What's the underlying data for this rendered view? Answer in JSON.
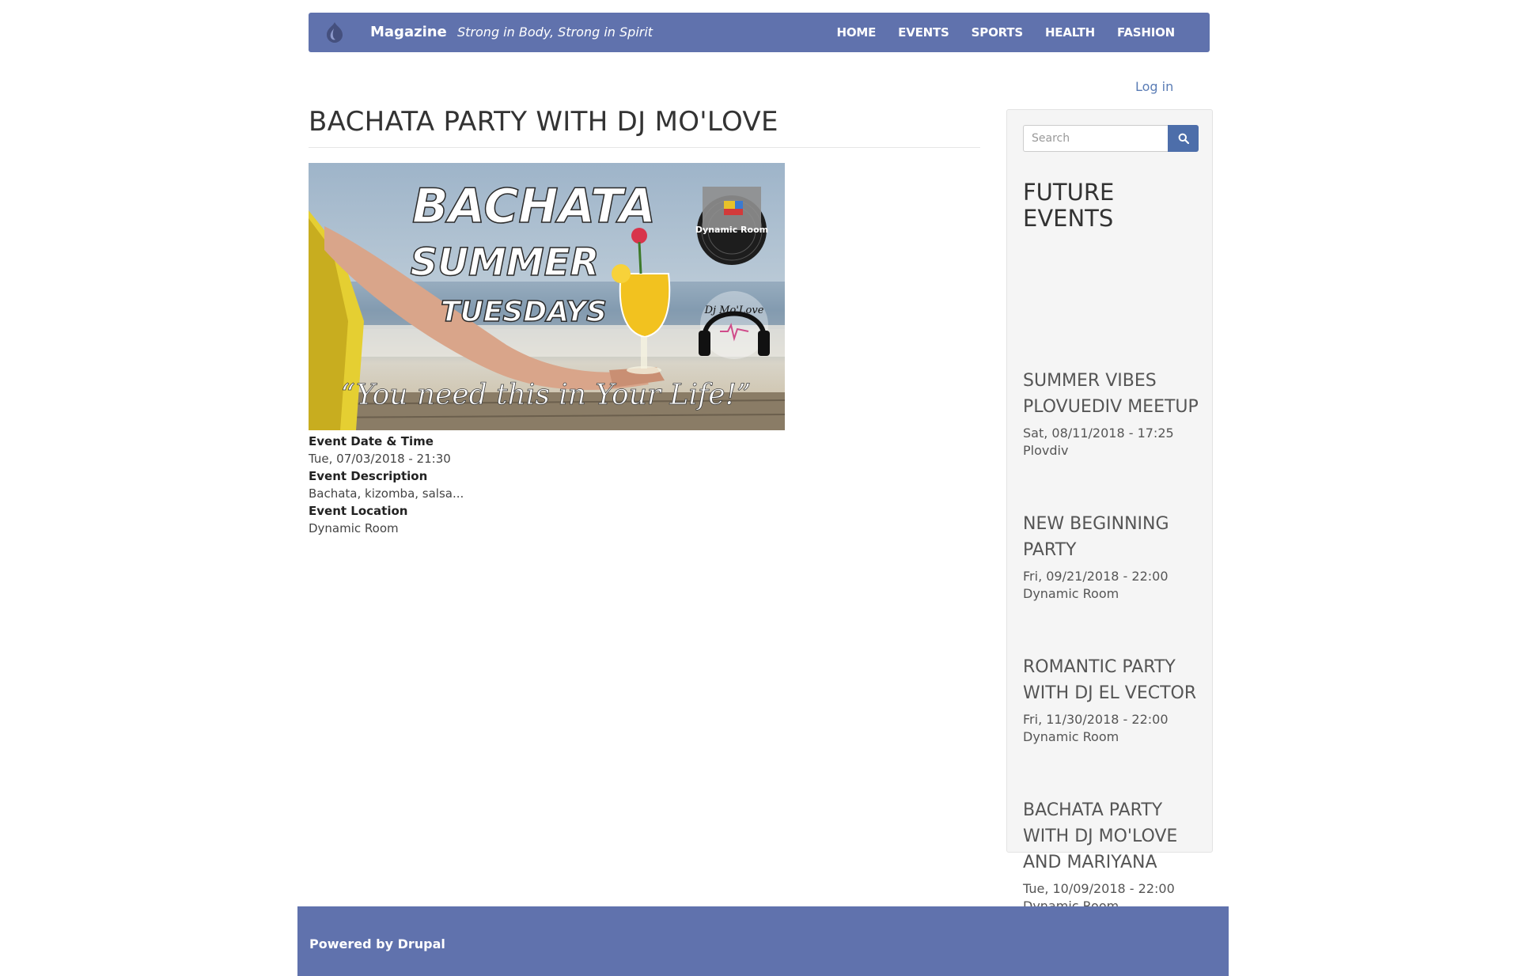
{
  "header": {
    "brand": "Magazine",
    "slogan": "Strong in Body, Strong in Spirit",
    "nav": [
      "HOME",
      "EVENTS",
      "SPORTS",
      "HEALTH",
      "FASHION"
    ],
    "accent_color": "#6072ad"
  },
  "user": {
    "login_label": "Log in"
  },
  "main": {
    "title": "BACHATA PARTY WITH DJ MO'LOVE",
    "image": {
      "headline_1": "BACHATA",
      "headline_2": "SUMMER",
      "headline_3": "TUESDAYS",
      "tagline": "“You need this in Your Life!”",
      "logo_1": "Dynamic Room",
      "logo_2": "Dj Mo'Love"
    },
    "fields": [
      {
        "label": "Event Date & Time",
        "value": "Tue, 07/03/2018 - 21:30"
      },
      {
        "label": "Event Description",
        "value": "Bachata, kizomba, salsa..."
      },
      {
        "label": "Event Location",
        "value": "Dynamic Room"
      }
    ]
  },
  "sidebar": {
    "search": {
      "placeholder": "Search",
      "button_icon": "search-icon"
    },
    "block_title": "FUTURE EVENTS",
    "events": [
      {
        "title": "SUMMER VIBES PLOVUEDIV MEETUP",
        "date": "Sat, 08/11/2018 - 17:25",
        "location": "Plovdiv"
      },
      {
        "title": "NEW BEGINNING PARTY",
        "date": "Fri, 09/21/2018 - 22:00",
        "location": "Dynamic Room"
      },
      {
        "title": "ROMANTIC PARTY WITH DJ EL VECTOR",
        "date": "Fri, 11/30/2018 - 22:00",
        "location": "Dynamic Room"
      },
      {
        "title": "BACHATA PARTY WITH DJ MO'LOVE AND MARIYANA",
        "date": "Tue, 10/09/2018 - 22:00",
        "location": "Dynamic Room"
      }
    ]
  },
  "footer": {
    "text": "Powered by Drupal"
  }
}
